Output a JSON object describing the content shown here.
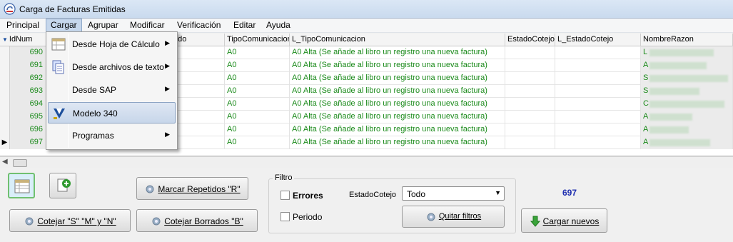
{
  "window": {
    "title": "Carga de Facturas Emitidas"
  },
  "menubar": [
    "Principal",
    "Cargar",
    "Agrupar",
    "Modificar",
    "Verificación",
    "Editar",
    "Ayuda"
  ],
  "dropdown": {
    "items": [
      {
        "label": "Desde Hoja de Cálculo",
        "icon": "spreadsheet-icon",
        "submenu": true
      },
      {
        "label": "Desde archivos de texto",
        "icon": "text-files-icon",
        "submenu": true
      },
      {
        "label": "Desde SAP",
        "icon": "",
        "submenu": true
      },
      {
        "label": "Modelo 340",
        "icon": "agencia-tributaria-icon",
        "submenu": false
      },
      {
        "label": "Programas",
        "icon": "",
        "submenu": true
      }
    ]
  },
  "grid": {
    "columns": [
      "IdNum",
      "odo",
      "TipoComunicacion",
      "L_TipoComunicacion",
      "EstadoCotejo",
      "L_EstadoCotejo",
      "NombreRazon"
    ],
    "rows": [
      {
        "id": "690",
        "tipo": "A0",
        "l_tipo": "A0 Alta (Se añade al libro un registro una nueva factura)",
        "nombre": "L"
      },
      {
        "id": "691",
        "tipo": "A0",
        "l_tipo": "A0 Alta (Se añade al libro un registro una nueva factura)",
        "nombre": "A"
      },
      {
        "id": "692",
        "tipo": "A0",
        "l_tipo": "A0 Alta (Se añade al libro un registro una nueva factura)",
        "nombre": "S"
      },
      {
        "id": "693",
        "tipo": "A0",
        "l_tipo": "A0 Alta (Se añade al libro un registro una nueva factura)",
        "nombre": "S"
      },
      {
        "id": "694",
        "tipo": "A0",
        "l_tipo": "A0 Alta (Se añade al libro un registro una nueva factura)",
        "nombre": "C"
      },
      {
        "id": "695",
        "tipo": "A0",
        "l_tipo": "A0 Alta (Se añade al libro un registro una nueva factura)",
        "nombre": "A"
      },
      {
        "id": "696",
        "tipo": "A0",
        "l_tipo": "A0 Alta (Se añade al libro un registro una nueva factura)",
        "nombre": "A"
      },
      {
        "id": "697",
        "tipo": "A0",
        "l_tipo": "A0 Alta (Se añade al libro un registro una nueva factura)",
        "nombre": "A"
      }
    ],
    "current_row_marker": "▶"
  },
  "buttons": {
    "marcar_repetidos": "Marcar Repetidos \"R\"",
    "cotejar_smn": "Cotejar \"S\" \"M\" y \"N\"",
    "cotejar_borrados": "Cotejar Borrados \"B\"",
    "quitar_filtros": "Quitar filtros",
    "cargar_nuevos": "Cargar nuevos"
  },
  "filtro": {
    "title": "Filtro",
    "errores_label": "Errores",
    "periodo_label": "Periodo",
    "estado_label": "EstadoCotejo",
    "estado_value": "Todo"
  },
  "record_count": "697",
  "colors": {
    "green_text": "#1a8a1a",
    "count_blue": "#1f2fb0",
    "menu_active": "#c6d7ec"
  }
}
